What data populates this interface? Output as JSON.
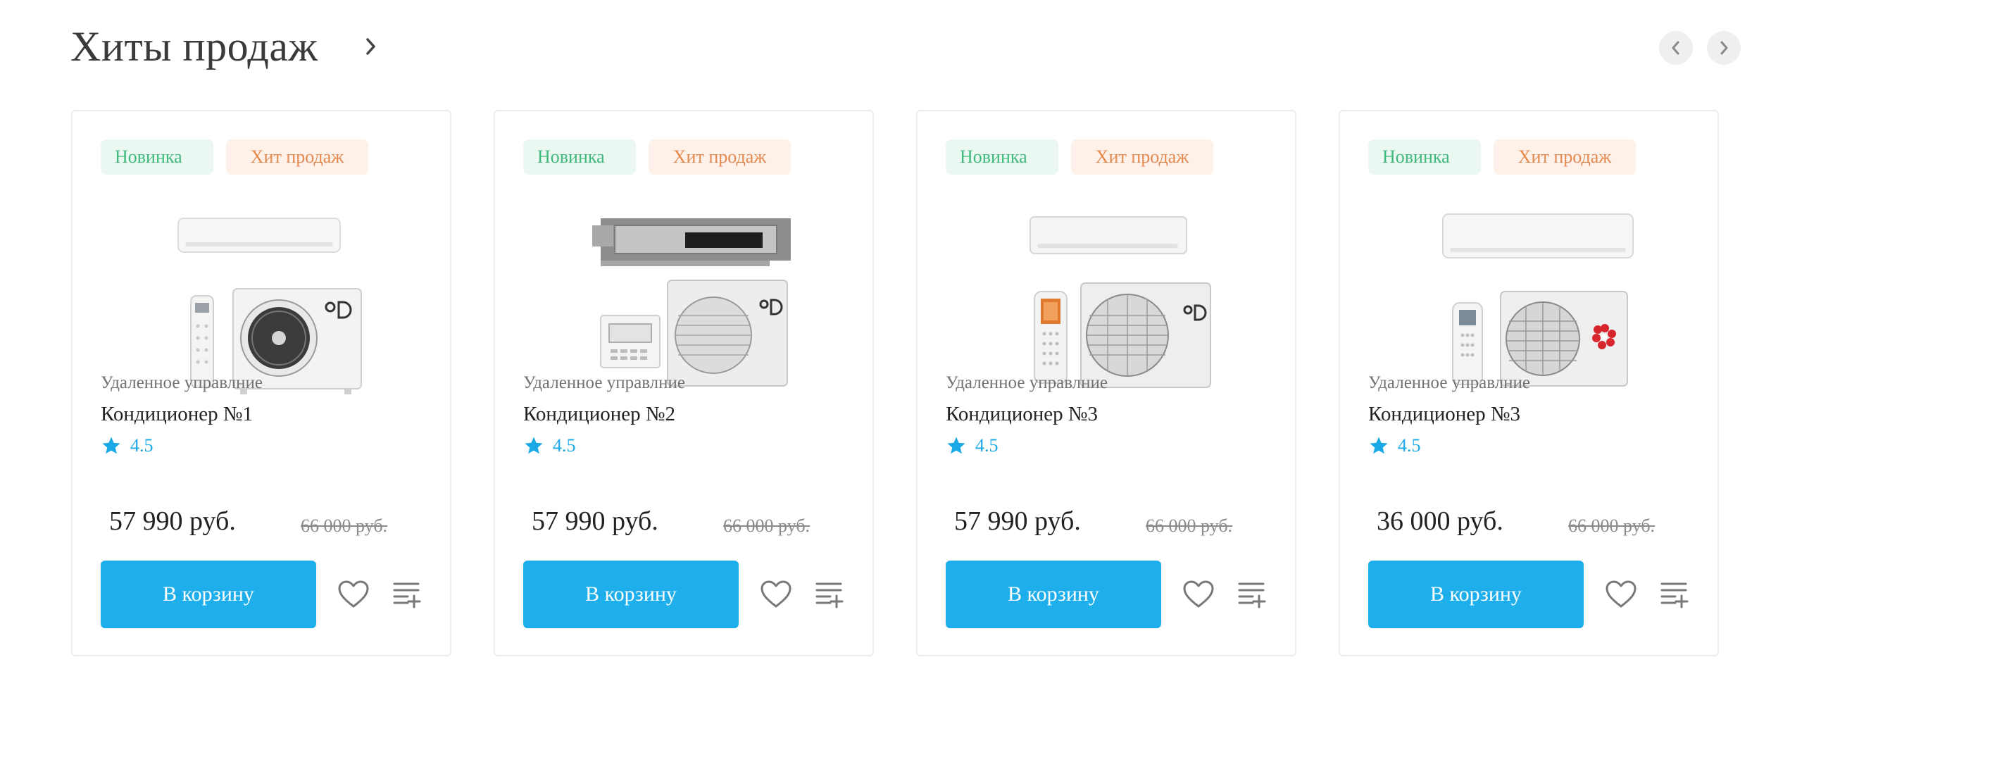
{
  "section": {
    "title": "Хиты продаж",
    "title_link_icon": "chevron-right-icon",
    "prev_icon": "chevron-left-icon",
    "next_icon": "chevron-right-icon"
  },
  "colors": {
    "accent": "#1eaeeb",
    "rating": "#1aa8e6",
    "badge_new_bg": "#eaf8f1",
    "badge_new_text": "#3fba7c",
    "badge_hit_bg": "#fdf1ea",
    "badge_hit_text": "#e5894f"
  },
  "products": [
    {
      "badge_new": "Новинка",
      "badge_hit": "Хит продаж",
      "image": "split-ac-wall-unit-with-round-fan-outdoor-unit-and-remote",
      "category": "Удаленное управлние",
      "name": "Кондиционер №1",
      "rating": "4.5",
      "price": "57 990 руб.",
      "old_price": "66 000 руб.",
      "cart_label": "В корзину"
    },
    {
      "badge_new": "Новинка",
      "badge_hit": "Хит продаж",
      "image": "ducted-ac-unit-with-outdoor-unit-and-wall-controller",
      "category": "Удаленное управлние",
      "name": "Кондиционер №2",
      "rating": "4.5",
      "price": "57 990 руб.",
      "old_price": "66 000 руб.",
      "cart_label": "В корзину"
    },
    {
      "badge_new": "Новинка",
      "badge_hit": "Хит продаж",
      "image": "split-ac-wall-unit-with-grille-outdoor-unit-and-remote",
      "category": "Удаленное управлние",
      "name": "Кондиционер №3",
      "rating": "4.5",
      "price": "57 990 руб.",
      "old_price": "66 000 руб.",
      "cart_label": "В корзину"
    },
    {
      "badge_new": "Новинка",
      "badge_hit": "Хит продаж",
      "image": "split-ac-wall-unit-with-red-logo-outdoor-unit-and-remote",
      "category": "Удаленное управлние",
      "name": "Кондиционер №3",
      "rating": "4.5",
      "price": "36 000 руб.",
      "old_price": "66 000 руб.",
      "cart_label": "В корзину"
    }
  ]
}
